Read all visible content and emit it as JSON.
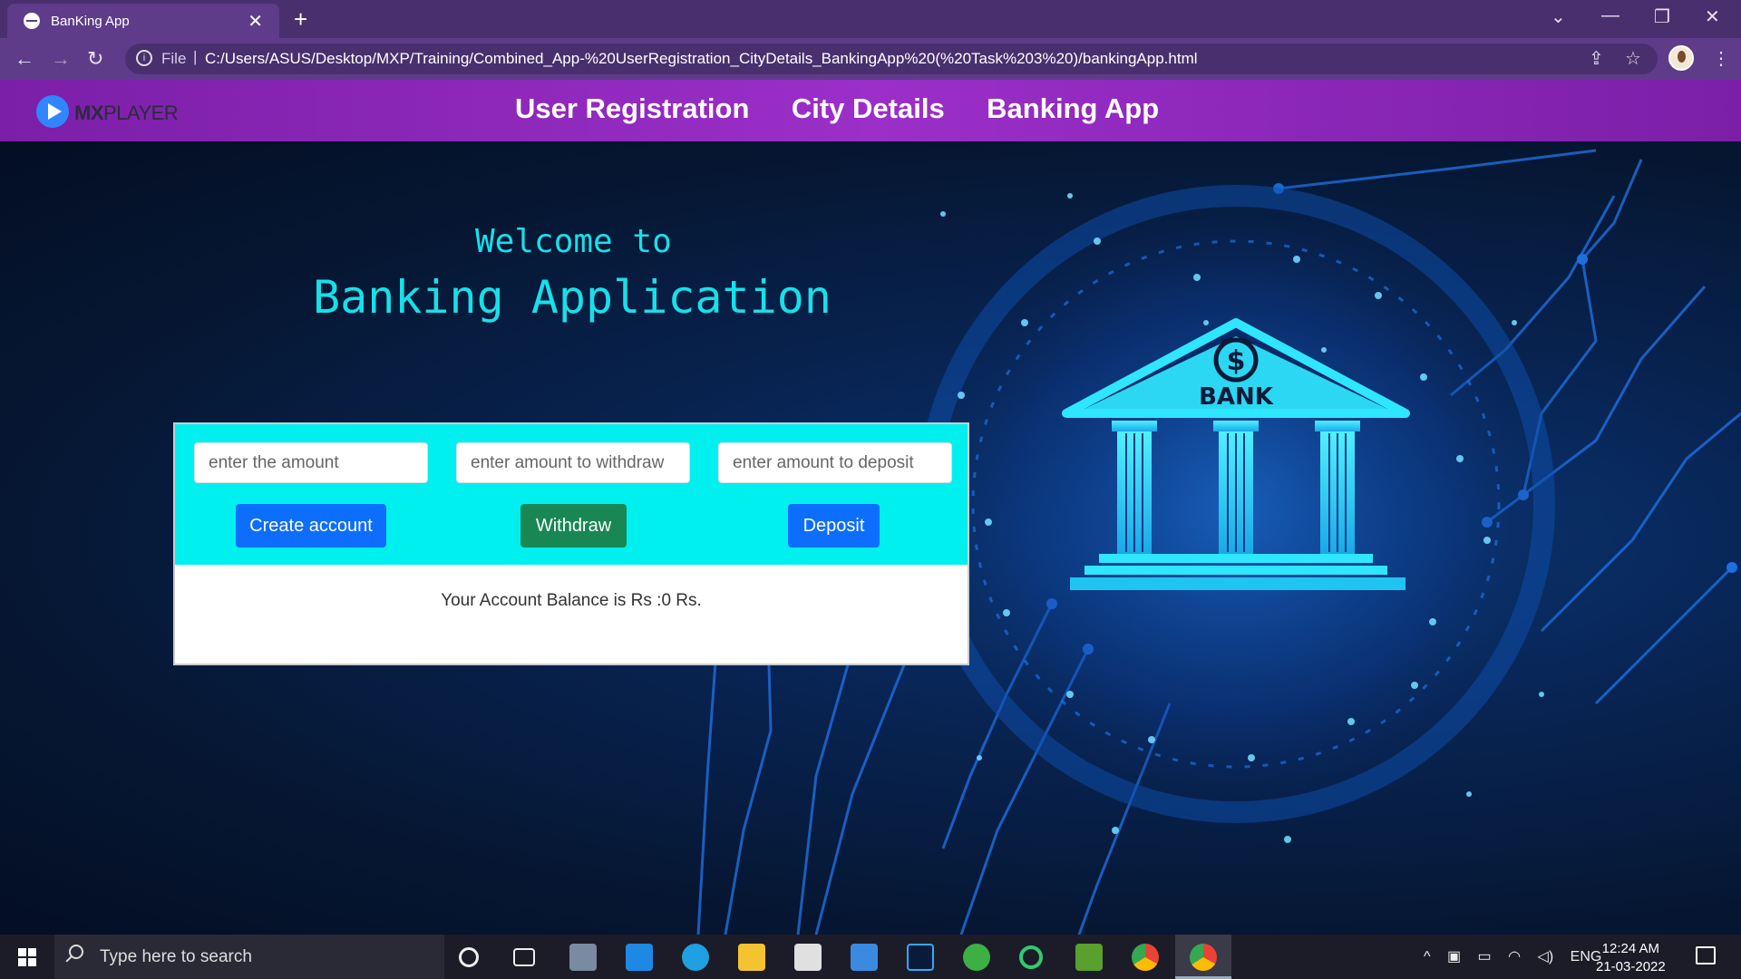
{
  "browser": {
    "tab_title": "BanKing App",
    "tab_close": "✕",
    "new_tab": "+",
    "file_label": "File",
    "url": "C:/Users/ASUS/Desktop/MXP/Training/Combined_App-%20UserRegistration_CityDetails_BankingApp%20(%20Task%203%20)/bankingApp.html"
  },
  "site": {
    "logo_mx": "MX",
    "logo_player": "PLAYER",
    "nav": [
      "User Registration",
      "City Details",
      "Banking App"
    ]
  },
  "hero": {
    "welcome": "Welcome to",
    "title": "Banking Application"
  },
  "form": {
    "amount_placeholder": "enter the amount",
    "withdraw_placeholder": "enter amount to withdraw",
    "deposit_placeholder": "enter amount to deposit",
    "create_label": "Create account",
    "withdraw_label": "Withdraw",
    "deposit_label": "Deposit",
    "balance_text": "Your Account Balance is Rs :0 Rs."
  },
  "art": {
    "bank_label": "BANK",
    "dollar": "$"
  },
  "taskbar": {
    "search_placeholder": "Type here to search",
    "lang": "ENG",
    "time": "12:24 AM",
    "date": "21-03-2022"
  }
}
